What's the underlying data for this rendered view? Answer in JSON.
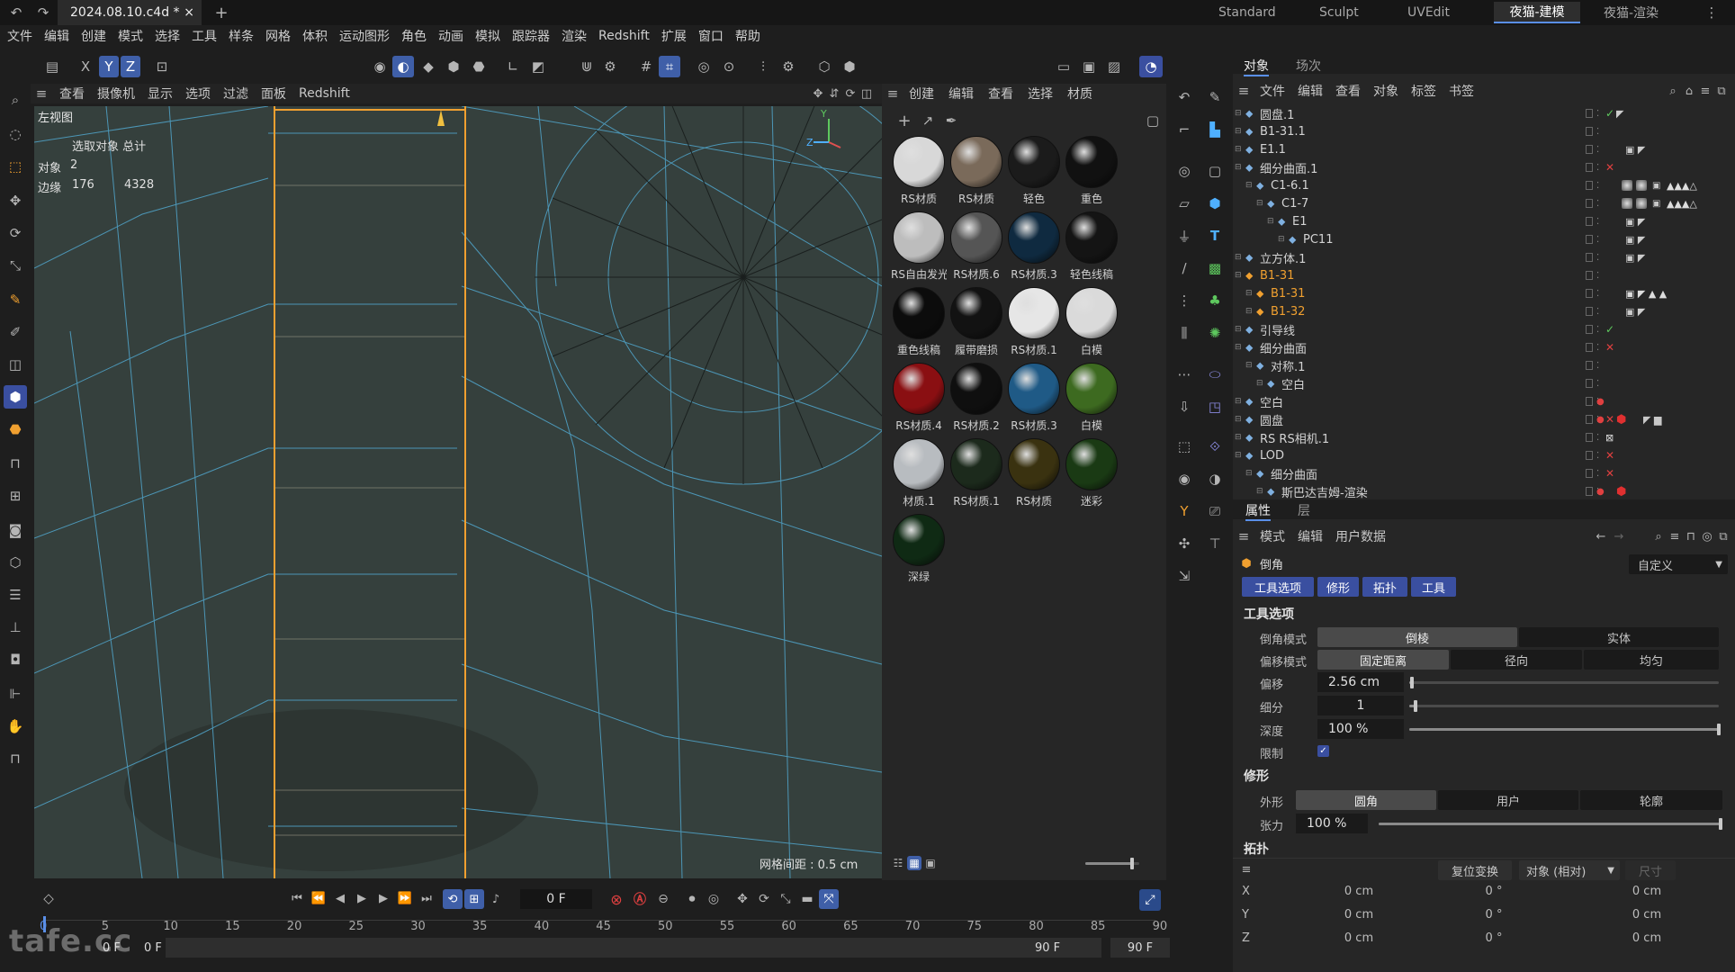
{
  "titlebar": {
    "document": "2024.08.10.c4d *",
    "close": "×",
    "add": "+",
    "layouts": [
      "Standard",
      "Sculpt",
      "UVEdit",
      "夜猫-建模",
      "夜猫-渲染"
    ],
    "active_layout": "夜猫-建模"
  },
  "menu": [
    "文件",
    "编辑",
    "创建",
    "模式",
    "选择",
    "工具",
    "样条",
    "网格",
    "体积",
    "运动图形",
    "角色",
    "动画",
    "模拟",
    "跟踪器",
    "渲染",
    "Redshift",
    "扩展",
    "窗口",
    "帮助"
  ],
  "toolbar": {
    "axis_x": "X",
    "axis_y": "Y",
    "axis_z": "Z"
  },
  "viewport": {
    "menu": [
      "查看",
      "摄像机",
      "显示",
      "选项",
      "过滤",
      "面板",
      "Redshift"
    ],
    "view_name": "左视图",
    "stats_header": "选取对象  总计",
    "stats_objects_label": "对象",
    "stats_objects": "2",
    "stats_edges_label": "边缘",
    "stats_edges_selected": "176",
    "stats_edges_total": "4328",
    "grid_spacing": "网格间距 : 0.5 cm",
    "axis_y": "Y",
    "axis_z": "Z"
  },
  "materials": {
    "menu": [
      "创建",
      "编辑",
      "查看",
      "选择",
      "材质"
    ],
    "items": [
      {
        "label": "RS材质",
        "color": "#d8d8d8"
      },
      {
        "label": "RS材质",
        "color": "#7a6a5a"
      },
      {
        "label": "轻色",
        "color": "#1b1b1b"
      },
      {
        "label": "重色",
        "color": "#111111"
      },
      {
        "label": "RS自由发光",
        "color": "#bdbdbd"
      },
      {
        "label": "RS材质.6",
        "color": "#555555"
      },
      {
        "label": "RS材质.3",
        "color": "#0f2a40"
      },
      {
        "label": "轻色线稿",
        "color": "#141414"
      },
      {
        "label": "重色线稿",
        "color": "#0c0c0c"
      },
      {
        "label": "履带磨损",
        "color": "#121212"
      },
      {
        "label": "RS材质.1",
        "color": "#e6e6e6"
      },
      {
        "label": "白模",
        "color": "#dadada"
      },
      {
        "label": "RS材质.4",
        "color": "#8a0f12"
      },
      {
        "label": "RS材质.2",
        "color": "#0f0f0f"
      },
      {
        "label": "RS材质.3",
        "color": "#1f5a86"
      },
      {
        "label": "白模",
        "color": "#3d6a20"
      },
      {
        "label": "材质.1",
        "color": "#b8bcc0"
      },
      {
        "label": "RS材质.1",
        "color": "#1c2a1c"
      },
      {
        "label": "RS材质",
        "color": "#3a3210"
      },
      {
        "label": "迷彩",
        "color": "#1a3a14"
      },
      {
        "label": "深绿",
        "color": "#0f2a14"
      }
    ]
  },
  "objects": {
    "tabs": [
      "对象",
      "场次"
    ],
    "active_tab": "对象",
    "menu": [
      "文件",
      "编辑",
      "查看",
      "对象",
      "标签",
      "书签"
    ],
    "rows": [
      {
        "name": "圆盘.1",
        "indent": 0,
        "hl": false
      },
      {
        "name": "B1-31.1",
        "indent": 0,
        "hl": false
      },
      {
        "name": "E1.1",
        "indent": 0,
        "hl": false
      },
      {
        "name": "细分曲面.1",
        "indent": 0,
        "hl": false
      },
      {
        "name": "C1-6.1",
        "indent": 1,
        "hl": false
      },
      {
        "name": "C1-7",
        "indent": 2,
        "hl": false
      },
      {
        "name": "E1",
        "indent": 3,
        "hl": false
      },
      {
        "name": "PC11",
        "indent": 4,
        "hl": false
      },
      {
        "name": "立方体.1",
        "indent": 0,
        "hl": false
      },
      {
        "name": "B1-31",
        "indent": 0,
        "hl": true
      },
      {
        "name": "B1-31",
        "indent": 1,
        "hl": true
      },
      {
        "name": "B1-32",
        "indent": 1,
        "hl": true
      },
      {
        "name": "引导线",
        "indent": 0,
        "hl": false
      },
      {
        "name": "细分曲面",
        "indent": 0,
        "hl": false
      },
      {
        "name": "对称.1",
        "indent": 1,
        "hl": false
      },
      {
        "name": "空白",
        "indent": 2,
        "hl": false
      },
      {
        "name": "空白",
        "indent": 0,
        "hl": false
      },
      {
        "name": "圆盘",
        "indent": 0,
        "hl": false
      },
      {
        "name": "RS RS相机.1",
        "indent": 0,
        "hl": false
      },
      {
        "name": "LOD",
        "indent": 0,
        "hl": false
      },
      {
        "name": "细分曲面",
        "indent": 1,
        "hl": false
      },
      {
        "name": "斯巴达吉姆-渲染",
        "indent": 2,
        "hl": false
      }
    ]
  },
  "attributes": {
    "tabs": [
      "属性",
      "层"
    ],
    "menu": [
      "模式",
      "编辑",
      "用户数据"
    ],
    "tool_name": "倒角",
    "preset": "自定义",
    "section_tabs": [
      "工具选项",
      "修形",
      "拓扑",
      "工具"
    ],
    "tool_options_title": "工具选项",
    "bevel_mode_label": "倒角模式",
    "bevel_mode_options": [
      "倒棱",
      "实体"
    ],
    "offset_mode_label": "偏移模式",
    "offset_mode_options": [
      "固定距离",
      "径向",
      "均匀"
    ],
    "offset_label": "偏移",
    "offset_value": "2.56 cm",
    "offset_level": 0.01,
    "subdiv_label": "细分",
    "subdiv_value": "1",
    "subdiv_level": 0.02,
    "depth_label": "深度",
    "depth_value": "100 %",
    "depth_level": 1.0,
    "limit_label": "限制",
    "limit_checked": true,
    "shaping_title": "修形",
    "shape_label": "外形",
    "shape_options": [
      "圆角",
      "用户",
      "轮廓"
    ],
    "tension_label": "张力",
    "tension_value": "100 %",
    "tension_level": 1.0,
    "topology_title": "拓扑",
    "reset_button": "复位变换",
    "coord_mode": "对象 (相对)",
    "size_label": "尺寸",
    "coords": [
      {
        "axis": "X",
        "pos": "0 cm",
        "rot": "0 °",
        "size": "0 cm"
      },
      {
        "axis": "Y",
        "pos": "0 cm",
        "rot": "0 °",
        "size": "0 cm"
      },
      {
        "axis": "Z",
        "pos": "0 cm",
        "rot": "0 °",
        "size": "0 cm"
      }
    ]
  },
  "timeline": {
    "frame": "0 F",
    "ticks": [
      "0",
      "5",
      "10",
      "15",
      "20",
      "25",
      "30",
      "35",
      "40",
      "45",
      "50",
      "55",
      "60",
      "65",
      "70",
      "75",
      "80",
      "85",
      "90"
    ],
    "start": "0 F",
    "start2": "0 F",
    "end": "90 F",
    "end2": "90 F"
  },
  "watermark": "tafe.cc"
}
